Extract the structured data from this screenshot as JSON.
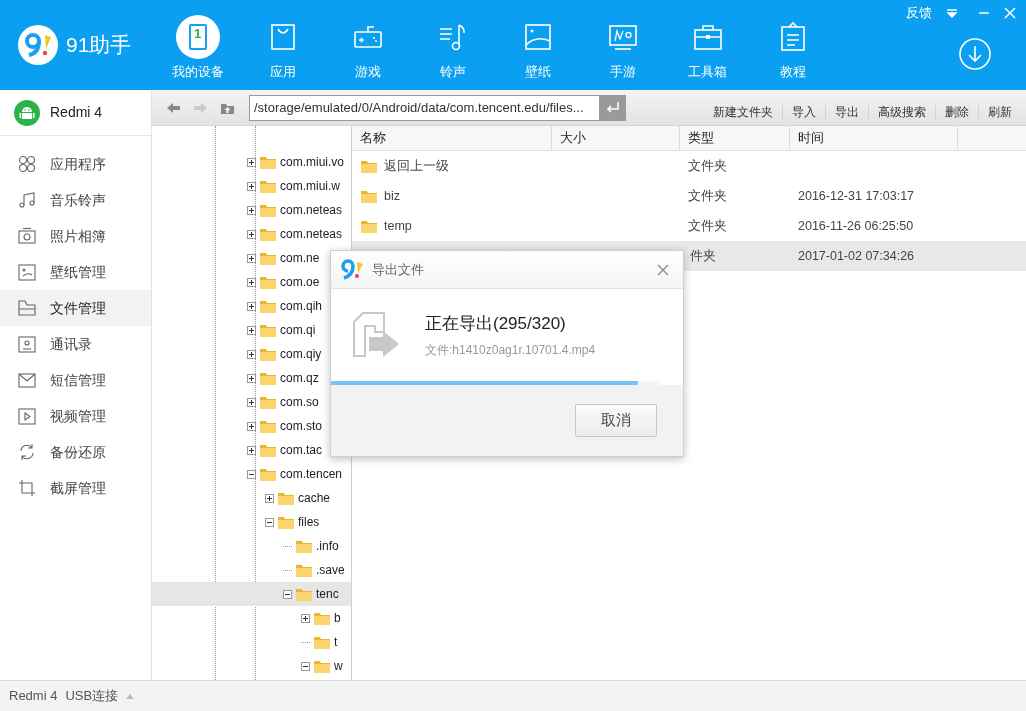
{
  "top_bar": {
    "app_name": "91助手",
    "feedback": "反馈",
    "nav": [
      {
        "label": "我的设备",
        "selected": true,
        "icon_text": "1"
      },
      {
        "label": "应用",
        "selected": false
      },
      {
        "label": "游戏",
        "selected": false
      },
      {
        "label": "铃声",
        "selected": false
      },
      {
        "label": "壁纸",
        "selected": false
      },
      {
        "label": "手游",
        "selected": false
      },
      {
        "label": "工具箱",
        "selected": false
      },
      {
        "label": "教程",
        "selected": false
      }
    ]
  },
  "sidebar": {
    "device": "Redmi 4",
    "items": [
      {
        "label": "应用程序",
        "selected": false
      },
      {
        "label": "音乐铃声",
        "selected": false
      },
      {
        "label": "照片相簿",
        "selected": false
      },
      {
        "label": "壁纸管理",
        "selected": false
      },
      {
        "label": "文件管理",
        "selected": true
      },
      {
        "label": "通讯录",
        "selected": false
      },
      {
        "label": "短信管理",
        "selected": false
      },
      {
        "label": "视频管理",
        "selected": false
      },
      {
        "label": "备份还原",
        "selected": false
      },
      {
        "label": "截屏管理",
        "selected": false
      }
    ]
  },
  "toolbar": {
    "path": "/storage/emulated/0/Android/data/com.tencent.edu/files...",
    "actions": [
      "新建文件夹",
      "导入",
      "导出",
      "高级搜索",
      "删除",
      "刷新"
    ]
  },
  "tree": [
    {
      "label": "com.miui.vo",
      "kind": "branch",
      "expanded": false,
      "selected": false
    },
    {
      "label": "com.miui.w",
      "kind": "branch",
      "expanded": false,
      "selected": false
    },
    {
      "label": "com.neteas",
      "kind": "branch",
      "expanded": false,
      "selected": false
    },
    {
      "label": "com.neteas",
      "kind": "branch",
      "expanded": false,
      "selected": false
    },
    {
      "label": "com.ne",
      "kind": "branch",
      "expanded": false,
      "selected": false
    },
    {
      "label": "com.oe",
      "kind": "branch",
      "expanded": false,
      "selected": false
    },
    {
      "label": "com.qih",
      "kind": "branch",
      "expanded": false,
      "selected": false
    },
    {
      "label": "com.qi",
      "kind": "branch",
      "expanded": false,
      "selected": false
    },
    {
      "label": "com.qiy",
      "kind": "branch",
      "expanded": false,
      "selected": false
    },
    {
      "label": "com.qz",
      "kind": "branch",
      "expanded": false,
      "selected": false
    },
    {
      "label": "com.so",
      "kind": "branch",
      "expanded": false,
      "selected": false
    },
    {
      "label": "com.sto",
      "kind": "branch",
      "expanded": false,
      "selected": false
    },
    {
      "label": "com.tac",
      "kind": "branch",
      "expanded": false,
      "selected": false
    },
    {
      "label": "com.tencen",
      "kind": "branch",
      "expanded": true,
      "selected": false,
      "children": [
        {
          "label": "cache",
          "kind": "branch",
          "expanded": false,
          "selected": false
        },
        {
          "label": "files",
          "kind": "branch",
          "expanded": true,
          "selected": false,
          "children": [
            {
              "label": ".info",
              "kind": "leaf",
              "selected": false
            },
            {
              "label": ".save",
              "kind": "leaf",
              "selected": false
            },
            {
              "label": "tenc",
              "kind": "branch",
              "expanded": true,
              "selected": true,
              "children": [
                {
                  "label": "b",
                  "kind": "branch",
                  "expanded": false,
                  "selected": false
                },
                {
                  "label": "t",
                  "kind": "leaf",
                  "selected": false
                },
                {
                  "label": "w",
                  "kind": "branch",
                  "expanded": true,
                  "selected": false
                }
              ]
            }
          ]
        }
      ]
    }
  ],
  "file_list": {
    "columns": [
      "名称",
      "大小",
      "类型",
      "时间"
    ],
    "rows": [
      {
        "name": "返回上一级",
        "type": "文件夹",
        "selected": false
      },
      {
        "name": "biz",
        "type": "文件夹",
        "time": "2016-12-31 17:03:17",
        "selected": false
      },
      {
        "name": "temp",
        "type": "文件夹",
        "time": "2016-11-26 06:25:50",
        "selected": false
      },
      {
        "type": "件夹",
        "time": "2017-01-02 07:34:26",
        "selected": true
      }
    ]
  },
  "dialog": {
    "title": "导出文件",
    "heading": "正在导出(295/320)",
    "file": "文件:h1410z0ag1r.10701.4.mp4",
    "level": 0.93,
    "cancel": "取消"
  },
  "status_bar": {
    "device": "Redmi 4",
    "connection": "USB连接"
  }
}
